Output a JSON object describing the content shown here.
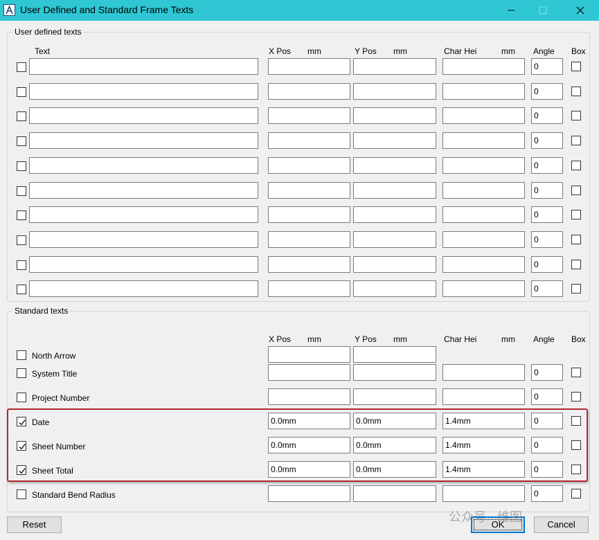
{
  "window": {
    "title": "User Defined and Standard Frame Texts",
    "icons": {
      "app": "app-logo-icon",
      "minimize": "minimize-icon",
      "maximize": "maximize-icon",
      "close": "close-icon"
    },
    "accent_color": "#2fc7d4",
    "highlight_color": "#b5262f"
  },
  "user_defined": {
    "title": "User defined texts",
    "headers": {
      "text": "Text",
      "xpos": "X Pos",
      "xpos_unit": "mm",
      "ypos": "Y Pos",
      "ypos_unit": "mm",
      "charhei": "Char Hei",
      "charhei_unit": "mm",
      "angle": "Angle",
      "box": "Box"
    },
    "rows": [
      {
        "checked": false,
        "text": "",
        "xpos": "",
        "ypos": "",
        "charhei": "",
        "angle": "0",
        "box": false
      },
      {
        "checked": false,
        "text": "",
        "xpos": "",
        "ypos": "",
        "charhei": "",
        "angle": "0",
        "box": false
      },
      {
        "checked": false,
        "text": "",
        "xpos": "",
        "ypos": "",
        "charhei": "",
        "angle": "0",
        "box": false
      },
      {
        "checked": false,
        "text": "",
        "xpos": "",
        "ypos": "",
        "charhei": "",
        "angle": "0",
        "box": false
      },
      {
        "checked": false,
        "text": "",
        "xpos": "",
        "ypos": "",
        "charhei": "",
        "angle": "0",
        "box": false
      },
      {
        "checked": false,
        "text": "",
        "xpos": "",
        "ypos": "",
        "charhei": "",
        "angle": "0",
        "box": false
      },
      {
        "checked": false,
        "text": "",
        "xpos": "",
        "ypos": "",
        "charhei": "",
        "angle": "0",
        "box": false
      },
      {
        "checked": false,
        "text": "",
        "xpos": "",
        "ypos": "",
        "charhei": "",
        "angle": "0",
        "box": false
      },
      {
        "checked": false,
        "text": "",
        "xpos": "",
        "ypos": "",
        "charhei": "",
        "angle": "0",
        "box": false
      },
      {
        "checked": false,
        "text": "",
        "xpos": "",
        "ypos": "",
        "charhei": "",
        "angle": "0",
        "box": false
      }
    ]
  },
  "standard": {
    "title": "Standard texts",
    "headers": {
      "xpos": "X Pos",
      "xpos_unit": "mm",
      "ypos": "Y Pos",
      "ypos_unit": "mm",
      "charhei": "Char Hei",
      "charhei_unit": "mm",
      "angle": "Angle",
      "box": "Box"
    },
    "rows": [
      {
        "label": "North Arrow",
        "checked": false,
        "xpos": "",
        "ypos": "",
        "has_charhei": false,
        "has_angle": false,
        "has_box": false
      },
      {
        "label": "System Title",
        "checked": false,
        "xpos": "",
        "ypos": "",
        "has_charhei": true,
        "charhei": "",
        "has_angle": true,
        "angle": "0",
        "has_box": true,
        "box": false
      },
      {
        "label": "Project Number",
        "checked": false,
        "xpos": "",
        "ypos": "",
        "has_charhei": true,
        "charhei": "",
        "has_angle": true,
        "angle": "0",
        "has_box": true,
        "box": false
      },
      {
        "label": "Date",
        "checked": true,
        "xpos": "0.0mm",
        "ypos": "0.0mm",
        "has_charhei": true,
        "charhei": "1.4mm",
        "has_angle": true,
        "angle": "0",
        "has_box": true,
        "box": false
      },
      {
        "label": "Sheet Number",
        "checked": true,
        "xpos": "0.0mm",
        "ypos": "0.0mm",
        "has_charhei": true,
        "charhei": "1.4mm",
        "has_angle": true,
        "angle": "0",
        "has_box": true,
        "box": false
      },
      {
        "label": "Sheet Total",
        "checked": true,
        "xpos": "0.0mm",
        "ypos": "0.0mm",
        "has_charhei": true,
        "charhei": "1.4mm",
        "has_angle": true,
        "angle": "0",
        "has_box": true,
        "box": false
      },
      {
        "label": "Standard Bend Radius",
        "checked": false,
        "xpos": "",
        "ypos": "",
        "has_charhei": true,
        "charhei": "",
        "has_angle": true,
        "angle": "0",
        "has_box": true,
        "box": false
      }
    ]
  },
  "buttons": {
    "reset": "Reset",
    "ok": "OK",
    "cancel": "Cancel"
  },
  "watermark": "公众号 · 维图"
}
